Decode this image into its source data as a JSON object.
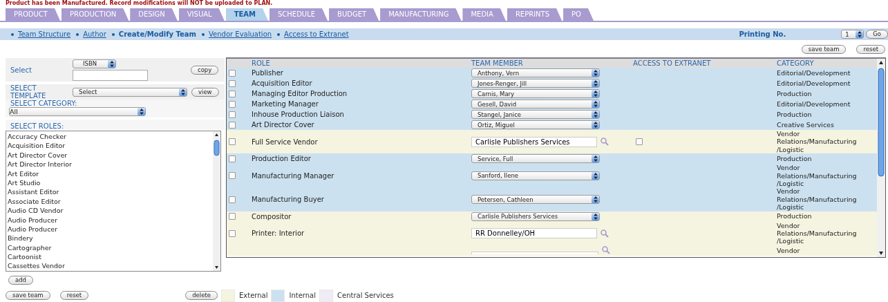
{
  "notice": "Product has been Manufactured. Record modifications will NOT be uploaded to PLAN.",
  "tabs": [
    {
      "label": "PRODUCT",
      "selected": false
    },
    {
      "label": "PRODUCTION",
      "selected": false
    },
    {
      "label": "DESIGN",
      "selected": false
    },
    {
      "label": "VISUAL",
      "selected": false
    },
    {
      "label": "TEAM",
      "selected": true
    },
    {
      "label": "SCHEDULE",
      "selected": false
    },
    {
      "label": "BUDGET",
      "selected": false
    },
    {
      "label": "MANUFACTURING",
      "selected": false
    },
    {
      "label": "MEDIA",
      "selected": false
    },
    {
      "label": "REPRINTS",
      "selected": false
    },
    {
      "label": "PO",
      "selected": false
    }
  ],
  "subnav": [
    {
      "label": "Team Structure",
      "selected": false
    },
    {
      "label": "Author",
      "selected": false
    },
    {
      "label": "Create/Modify Team",
      "selected": true
    },
    {
      "label": "Vendor Evaluation",
      "selected": false
    },
    {
      "label": "Access to Extranet",
      "selected": false
    }
  ],
  "printing": {
    "label": "Printing No.",
    "value": "1",
    "button": "Go"
  },
  "top_buttons": [
    "save team",
    "reset"
  ],
  "left": {
    "select_label": "Select",
    "select_value": "ISBN",
    "copy": "copy",
    "template_label": "SELECT TEMPLATE",
    "template_value": "Select",
    "view": "view",
    "category_label": "SELECT CATEGORY:",
    "category_value": "All",
    "roles_label": "SELECT ROLES:",
    "roles": [
      "Accuracy Checker",
      "Acquisition Editor",
      "Art Director Cover",
      "Art Director Interior",
      "Art Editor",
      "Art Studio",
      "Assistant Editor",
      "Associate Editor",
      "Audio CD Vendor",
      "Audio Producer",
      "Audio Producer",
      "Bindery",
      "Cartographer",
      "Cartoonist",
      "Cassettes Vendor"
    ],
    "add": "add"
  },
  "table": {
    "columns": [
      "ROLE",
      "TEAM MEMBER",
      "ACCESS TO EXTRANET",
      "CATEGORY"
    ],
    "rows": [
      {
        "color": "#cce1f0",
        "kind": "select",
        "checked": false,
        "role": "Publisher",
        "member": "Anthony, Vern",
        "category": "Editorial/Development"
      },
      {
        "color": "#cce1f0",
        "kind": "select",
        "checked": false,
        "role": "Acquisition Editor",
        "member": "Jones-Renger, Jill",
        "category": "Editorial/Development"
      },
      {
        "color": "#cce1f0",
        "kind": "select",
        "checked": false,
        "role": "Managing Editor Production",
        "member": "Carnis, Mary",
        "category": "Production"
      },
      {
        "color": "#cce1f0",
        "kind": "select",
        "checked": false,
        "role": "Marketing Manager",
        "member": "Gesell, David",
        "category": "Editorial/Development"
      },
      {
        "color": "#cce1f0",
        "kind": "select",
        "checked": false,
        "role": "Inhouse Production Liaison",
        "member": "Stangel, Janice",
        "category": "Production"
      },
      {
        "color": "#cce1f0",
        "kind": "select",
        "checked": false,
        "role": "Art Director Cover",
        "member": "Ortiz, Miguel",
        "category": "Creative Services"
      },
      {
        "color": "#f5f4e0",
        "kind": "field",
        "checked": false,
        "role": "Full Service Vendor",
        "member": "Carlisle Publishers Services",
        "extranet": false,
        "category": "Vendor Relations/Manufacturing /Logistic"
      },
      {
        "color": "#cce1f0",
        "kind": "select",
        "checked": false,
        "role": "Production Editor",
        "member": "Service, Full",
        "category": "Production"
      },
      {
        "color": "#cce1f0",
        "kind": "select",
        "checked": false,
        "role": "Manufacturing Manager",
        "member": "Sanford, Ilene",
        "category": "Vendor Relations/Manufacturing /Logistic"
      },
      {
        "color": "#cce1f0",
        "kind": "select",
        "checked": false,
        "role": "Manufacturing Buyer",
        "member": "Petersen, Cathleen",
        "category": "Vendor Relations/Manufacturing /Logistic"
      },
      {
        "color": "#f5f4e0",
        "kind": "select",
        "checked": false,
        "role": "Compositor",
        "member": "Carlisle Publishers Services",
        "category": "Production"
      },
      {
        "color": "#f5f4e0",
        "kind": "field",
        "checked": false,
        "role": "Printer: Interior",
        "member": "RR Donnelley/OH",
        "category": "Vendor Relations/Manufacturing /Logistic"
      },
      {
        "color": "#f5f4e0",
        "kind": "partial",
        "category": "Vendor"
      }
    ]
  },
  "bottom_buttons": [
    "save team",
    "reset"
  ],
  "delete": "delete",
  "legend": [
    {
      "label": "External",
      "color": "#f5f4e0"
    },
    {
      "label": "Internal",
      "color": "#cce1f0"
    },
    {
      "label": "Central Services",
      "color": "#efecf6"
    }
  ]
}
